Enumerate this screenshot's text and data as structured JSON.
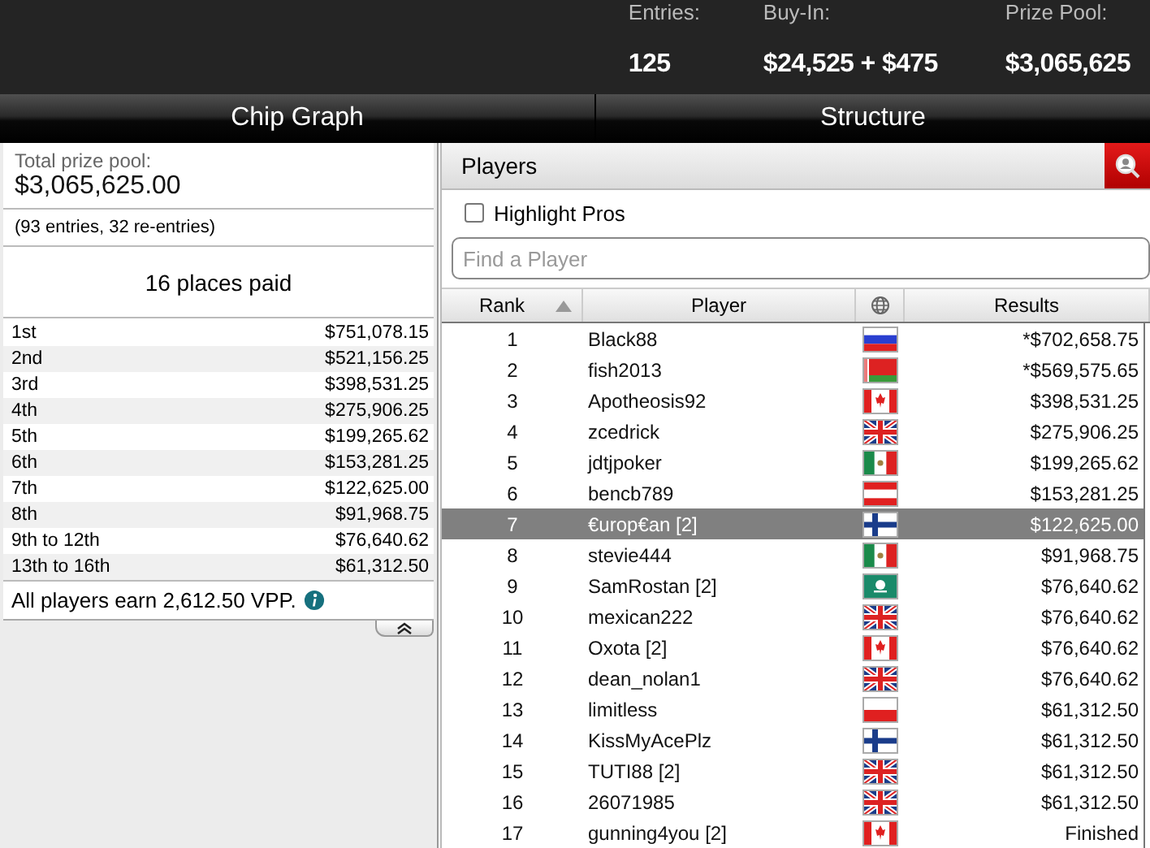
{
  "stats": [
    {
      "label": "Entries:",
      "value": "125"
    },
    {
      "label": "Buy-In:",
      "value": "$24,525 + $475"
    },
    {
      "label": "Prize Pool:",
      "value": "$3,065,625"
    }
  ],
  "tabs": [
    {
      "label": "Chip Graph"
    },
    {
      "label": "Structure"
    }
  ],
  "prize_panel": {
    "total_label": "Total prize pool:",
    "total": "$3,065,625.00",
    "entries_note": "(93 entries, 32 re-entries)",
    "places_paid": "16 places paid",
    "payouts": [
      {
        "place": "1st",
        "amount": "$751,078.15"
      },
      {
        "place": "2nd",
        "amount": "$521,156.25"
      },
      {
        "place": "3rd",
        "amount": "$398,531.25"
      },
      {
        "place": "4th",
        "amount": "$275,906.25"
      },
      {
        "place": "5th",
        "amount": "$199,265.62"
      },
      {
        "place": "6th",
        "amount": "$153,281.25"
      },
      {
        "place": "7th",
        "amount": "$122,625.00"
      },
      {
        "place": "8th",
        "amount": "$91,968.75"
      },
      {
        "place": "9th to 12th",
        "amount": "$76,640.62"
      },
      {
        "place": "13th to 16th",
        "amount": "$61,312.50"
      }
    ],
    "vpp_note": "All players earn 2,612.50 VPP."
  },
  "players_panel": {
    "title": "Players",
    "highlight_pros": {
      "label": "Highlight Pros",
      "checked": false
    },
    "search": {
      "placeholder": "Find a Player"
    },
    "columns": [
      "Rank",
      "Player",
      "Results"
    ],
    "rows": [
      {
        "rank": "1",
        "player": "Black88",
        "kind": "ru",
        "result": "*$702,658.75",
        "selected": false
      },
      {
        "rank": "2",
        "player": "fish2013",
        "kind": "by",
        "result": "*$569,575.65",
        "selected": false
      },
      {
        "rank": "3",
        "player": "Apotheosis92",
        "kind": "ca",
        "result": "$398,531.25",
        "selected": false
      },
      {
        "rank": "4",
        "player": "zcedrick",
        "kind": "gb",
        "result": "$275,906.25",
        "selected": false
      },
      {
        "rank": "5",
        "player": "jdtjpoker",
        "kind": "mx",
        "result": "$199,265.62",
        "selected": false
      },
      {
        "rank": "6",
        "player": "bencb789",
        "kind": "at",
        "result": "$153,281.25",
        "selected": false
      },
      {
        "rank": "7",
        "player": "€urop€an [2]",
        "kind": "fi",
        "result": "$122,625.00",
        "selected": true
      },
      {
        "rank": "8",
        "player": "stevie444",
        "kind": "mx",
        "result": "$91,968.75",
        "selected": false
      },
      {
        "rank": "9",
        "player": "SamRostan [2]",
        "kind": "mo",
        "result": "$76,640.62",
        "selected": false
      },
      {
        "rank": "10",
        "player": "mexican222",
        "kind": "gb",
        "result": "$76,640.62",
        "selected": false
      },
      {
        "rank": "11",
        "player": "Oxota [2]",
        "kind": "ca",
        "result": "$76,640.62",
        "selected": false
      },
      {
        "rank": "12",
        "player": "dean_nolan1",
        "kind": "gb",
        "result": "$76,640.62",
        "selected": false
      },
      {
        "rank": "13",
        "player": "limitless",
        "kind": "pl",
        "result": "$61,312.50",
        "selected": false
      },
      {
        "rank": "14",
        "player": "KissMyAcePlz",
        "kind": "fi",
        "result": "$61,312.50",
        "selected": false
      },
      {
        "rank": "15",
        "player": "TUTI88 [2]",
        "kind": "gb",
        "result": "$61,312.50",
        "selected": false
      },
      {
        "rank": "16",
        "player": "26071985",
        "kind": "gb",
        "result": "$61,312.50",
        "selected": false
      },
      {
        "rank": "17",
        "player": "gunning4you [2]",
        "kind": "ca",
        "result": "Finished",
        "selected": false
      }
    ]
  }
}
